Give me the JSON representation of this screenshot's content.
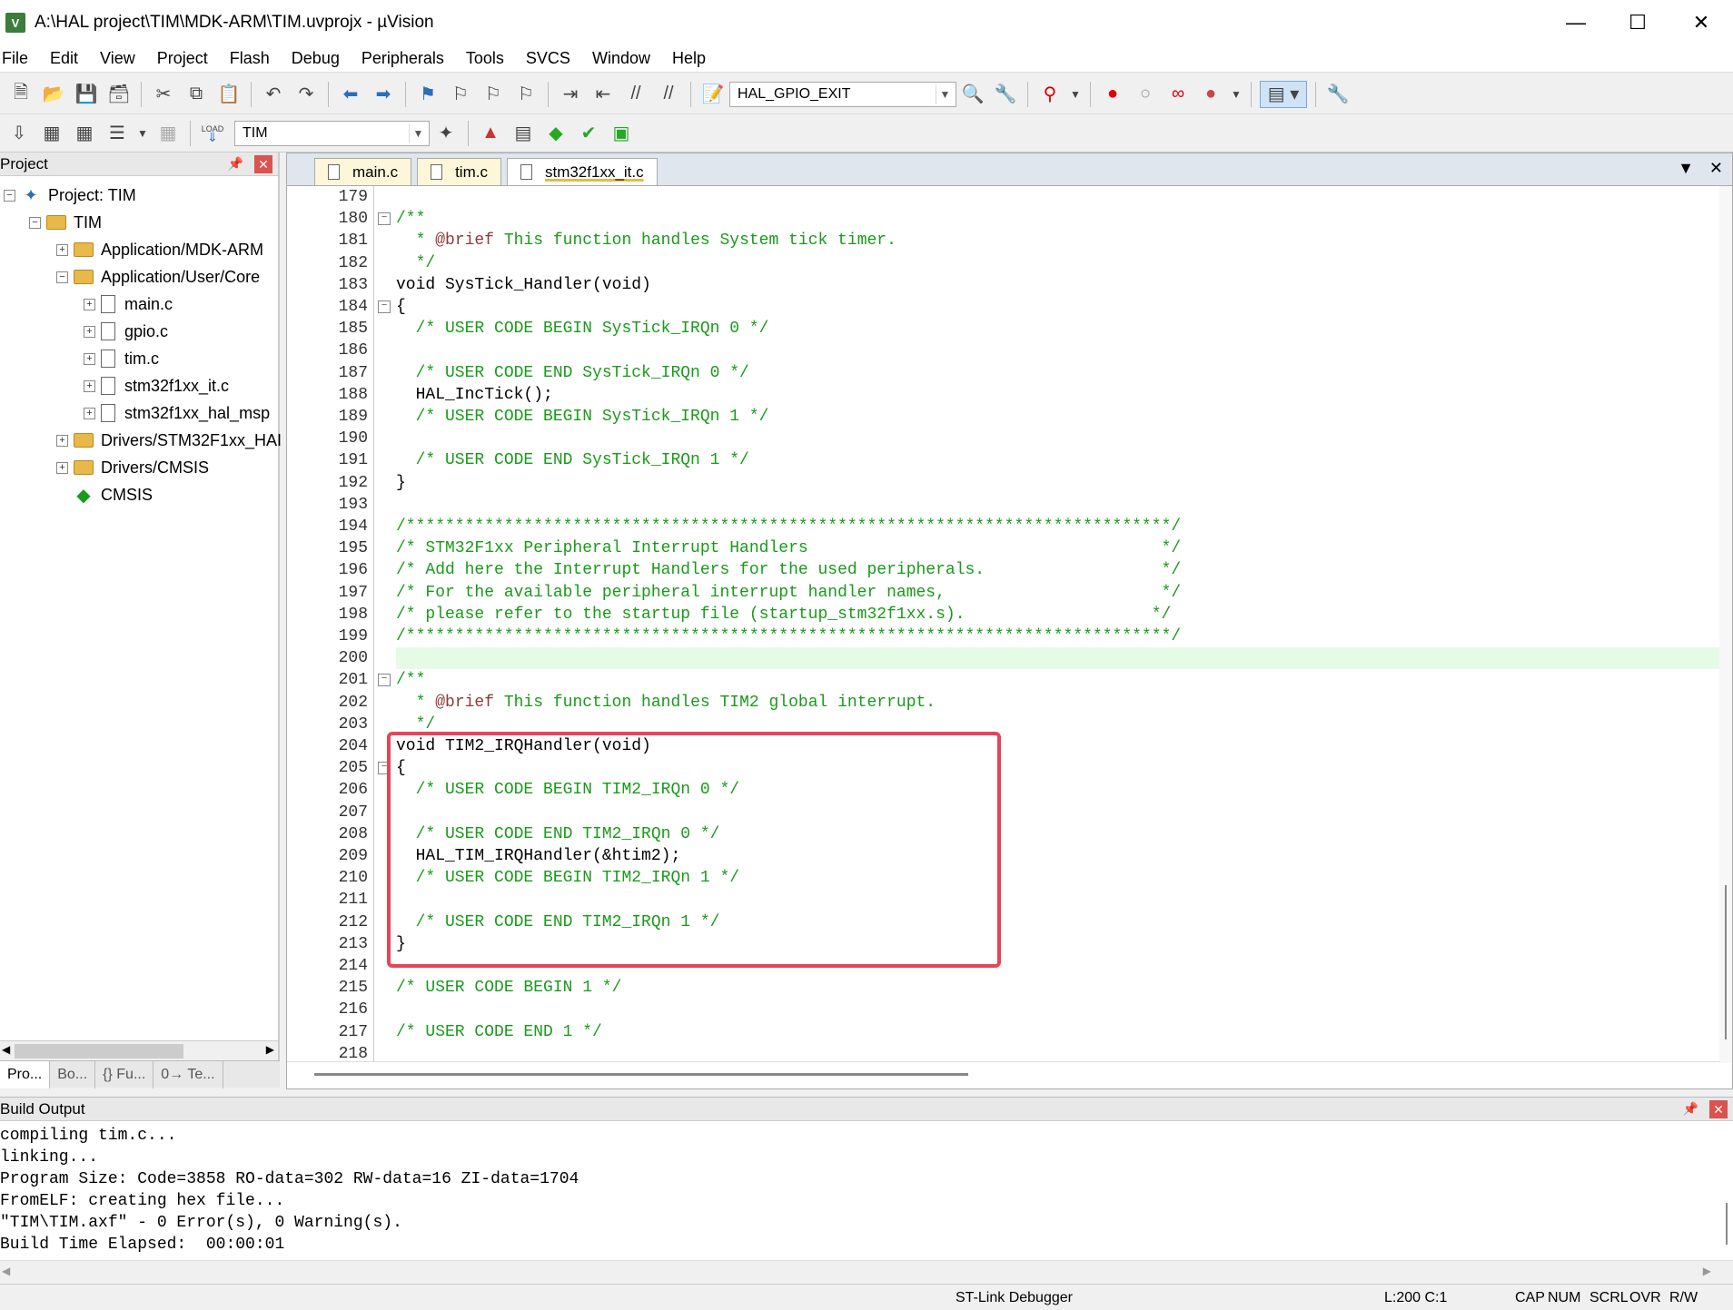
{
  "window": {
    "title": "A:\\HAL project\\TIM\\MDK-ARM\\TIM.uvprojx - µVision",
    "app_icon": "V"
  },
  "menu": [
    "File",
    "Edit",
    "View",
    "Project",
    "Flash",
    "Debug",
    "Peripherals",
    "Tools",
    "SVCS",
    "Window",
    "Help"
  ],
  "toolbar": {
    "find_combo": "HAL_GPIO_EXIT",
    "target_combo": "TIM",
    "load_label": "LOAD"
  },
  "project_panel": {
    "title": "Project",
    "tree": [
      {
        "label": "Project: TIM",
        "level": 0,
        "kind": "project",
        "expander": "−"
      },
      {
        "label": "TIM",
        "level": 1,
        "kind": "target",
        "expander": "−"
      },
      {
        "label": "Application/MDK-ARM",
        "level": 2,
        "kind": "folder",
        "expander": "+"
      },
      {
        "label": "Application/User/Core",
        "level": 2,
        "kind": "folder",
        "expander": "−"
      },
      {
        "label": "main.c",
        "level": 3,
        "kind": "file",
        "expander": "+"
      },
      {
        "label": "gpio.c",
        "level": 3,
        "kind": "file",
        "expander": "+"
      },
      {
        "label": "tim.c",
        "level": 3,
        "kind": "file",
        "expander": "+"
      },
      {
        "label": "stm32f1xx_it.c",
        "level": 3,
        "kind": "file",
        "expander": "+"
      },
      {
        "label": "stm32f1xx_hal_msp",
        "level": 3,
        "kind": "file",
        "expander": "+"
      },
      {
        "label": "Drivers/STM32F1xx_HAI",
        "level": 2,
        "kind": "folder",
        "expander": "+"
      },
      {
        "label": "Drivers/CMSIS",
        "level": 2,
        "kind": "folder",
        "expander": "+"
      },
      {
        "label": "CMSIS",
        "level": 2,
        "kind": "cmsis",
        "expander": ""
      }
    ],
    "bottom_tabs": [
      "Pro...",
      "Bo...",
      "{} Fu...",
      "0→ Te..."
    ]
  },
  "editor": {
    "tabs": [
      "main.c",
      "tim.c",
      "stm32f1xx_it.c"
    ],
    "active_tab": 2,
    "highlight_line": 200,
    "lines": [
      {
        "n": "179",
        "t": "",
        "fold": ""
      },
      {
        "n": "180",
        "t": "/**",
        "fold": "−",
        "c": true
      },
      {
        "n": "181",
        "t": "  * @brief This function handles System tick timer.",
        "fold": "",
        "c": true
      },
      {
        "n": "182",
        "t": "  */",
        "fold": "",
        "c": true
      },
      {
        "n": "183",
        "t": "void SysTick_Handler(void)",
        "fold": ""
      },
      {
        "n": "184",
        "t": "{",
        "fold": "−"
      },
      {
        "n": "185",
        "t": "  /* USER CODE BEGIN SysTick_IRQn 0 */",
        "fold": "",
        "c": true
      },
      {
        "n": "186",
        "t": "",
        "fold": ""
      },
      {
        "n": "187",
        "t": "  /* USER CODE END SysTick_IRQn 0 */",
        "fold": "",
        "c": true
      },
      {
        "n": "188",
        "t": "  HAL_IncTick();",
        "fold": ""
      },
      {
        "n": "189",
        "t": "  /* USER CODE BEGIN SysTick_IRQn 1 */",
        "fold": "",
        "c": true
      },
      {
        "n": "190",
        "t": "",
        "fold": ""
      },
      {
        "n": "191",
        "t": "  /* USER CODE END SysTick_IRQn 1 */",
        "fold": "",
        "c": true
      },
      {
        "n": "192",
        "t": "}",
        "fold": ""
      },
      {
        "n": "193",
        "t": "",
        "fold": ""
      },
      {
        "n": "194",
        "t": "/******************************************************************************/",
        "fold": "",
        "c": true
      },
      {
        "n": "195",
        "t": "/* STM32F1xx Peripheral Interrupt Handlers                                    */",
        "fold": "",
        "c": true
      },
      {
        "n": "196",
        "t": "/* Add here the Interrupt Handlers for the used peripherals.                  */",
        "fold": "",
        "c": true
      },
      {
        "n": "197",
        "t": "/* For the available peripheral interrupt handler names,                      */",
        "fold": "",
        "c": true
      },
      {
        "n": "198",
        "t": "/* please refer to the startup file (startup_stm32f1xx.s).                   */",
        "fold": "",
        "c": true
      },
      {
        "n": "199",
        "t": "/******************************************************************************/",
        "fold": "",
        "c": true
      },
      {
        "n": "200",
        "t": "",
        "fold": ""
      },
      {
        "n": "201",
        "t": "/**",
        "fold": "−",
        "c": true
      },
      {
        "n": "202",
        "t": "  * @brief This function handles TIM2 global interrupt.",
        "fold": "",
        "c": true
      },
      {
        "n": "203",
        "t": "  */",
        "fold": "",
        "c": true
      },
      {
        "n": "204",
        "t": "void TIM2_IRQHandler(void)",
        "fold": ""
      },
      {
        "n": "205",
        "t": "{",
        "fold": "−"
      },
      {
        "n": "206",
        "t": "  /* USER CODE BEGIN TIM2_IRQn 0 */",
        "fold": "",
        "c": true
      },
      {
        "n": "207",
        "t": "",
        "fold": ""
      },
      {
        "n": "208",
        "t": "  /* USER CODE END TIM2_IRQn 0 */",
        "fold": "",
        "c": true
      },
      {
        "n": "209",
        "t": "  HAL_TIM_IRQHandler(&htim2);",
        "fold": ""
      },
      {
        "n": "210",
        "t": "  /* USER CODE BEGIN TIM2_IRQn 1 */",
        "fold": "",
        "c": true
      },
      {
        "n": "211",
        "t": "",
        "fold": ""
      },
      {
        "n": "212",
        "t": "  /* USER CODE END TIM2_IRQn 1 */",
        "fold": "",
        "c": true
      },
      {
        "n": "213",
        "t": "}",
        "fold": ""
      },
      {
        "n": "214",
        "t": "",
        "fold": ""
      },
      {
        "n": "215",
        "t": "/* USER CODE BEGIN 1 */",
        "fold": "",
        "c": true
      },
      {
        "n": "216",
        "t": "",
        "fold": ""
      },
      {
        "n": "217",
        "t": "/* USER CODE END 1 */",
        "fold": "",
        "c": true
      },
      {
        "n": "218",
        "t": "",
        "fold": ""
      }
    ]
  },
  "build_output": {
    "title": "Build Output",
    "lines": [
      "compiling tim.c...",
      "linking...",
      "Program Size: Code=3858 RO-data=302 RW-data=16 ZI-data=1704",
      "FromELF: creating hex file...",
      "\"TIM\\TIM.axf\" - 0 Error(s), 0 Warning(s).",
      "Build Time Elapsed:  00:00:01"
    ]
  },
  "status": {
    "debugger": "ST-Link Debugger",
    "position": "L:200 C:1",
    "cap": "CAP",
    "num": "NUM",
    "scrl": "SCRL",
    "ovr": "OVR",
    "rw": "R/W"
  },
  "colors": {
    "comment": "#1a9a1a",
    "highlight_line": "#e6fbe6",
    "annotation_box": "#e8435a"
  }
}
